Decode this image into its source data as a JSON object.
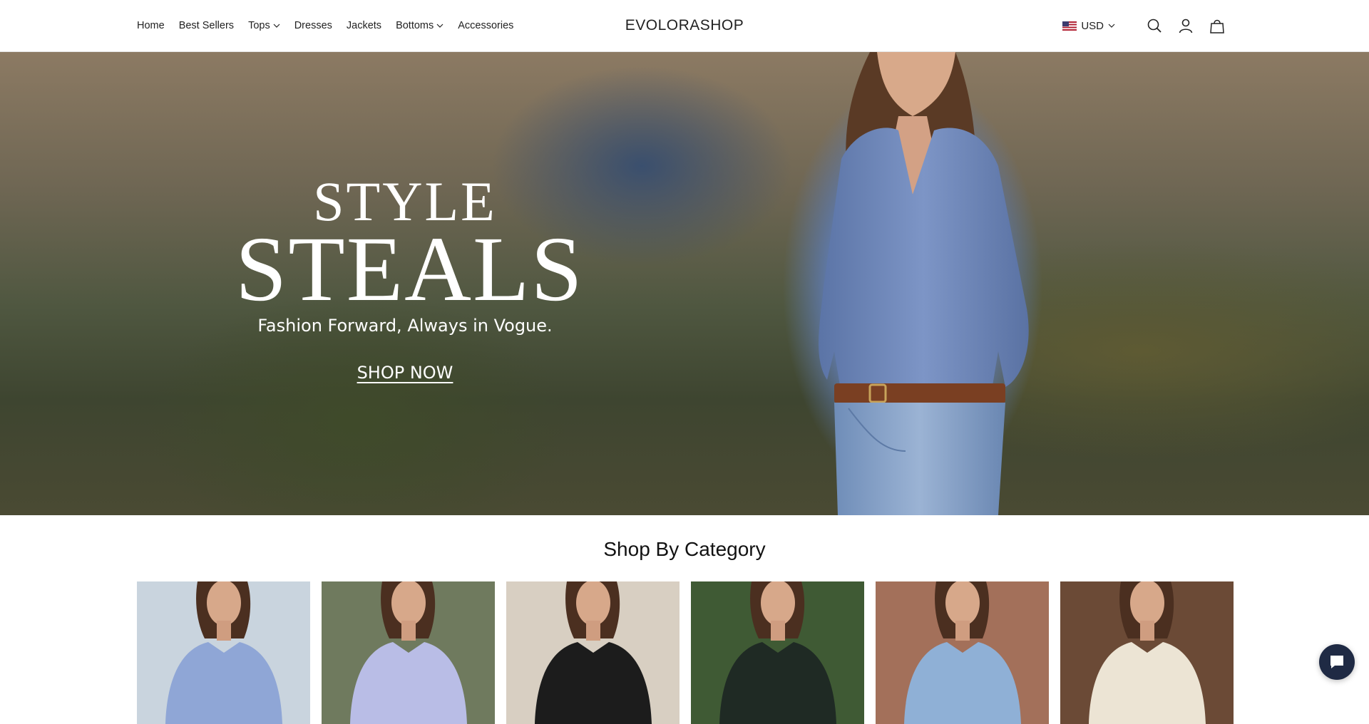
{
  "header": {
    "nav": [
      {
        "label": "Home",
        "has_dropdown": false
      },
      {
        "label": "Best Sellers",
        "has_dropdown": false
      },
      {
        "label": "Tops",
        "has_dropdown": true
      },
      {
        "label": "Dresses",
        "has_dropdown": false
      },
      {
        "label": "Jackets",
        "has_dropdown": false
      },
      {
        "label": "Bottoms",
        "has_dropdown": true
      },
      {
        "label": "Accessories",
        "has_dropdown": false
      }
    ],
    "logo": "EVOLORASHOP",
    "currency": "USD",
    "icons": [
      "us-flag-icon",
      "search-icon",
      "account-icon",
      "cart-icon"
    ]
  },
  "hero": {
    "line1": "STYLE",
    "line2": "STEALS",
    "tagline": "Fashion Forward, Always in Vogue.",
    "cta": "SHOP NOW"
  },
  "category": {
    "title": "Shop By Category",
    "cards": [
      {
        "name": "category-card-1",
        "bg": "#c9d4de",
        "shirt": "#8fa6d6"
      },
      {
        "name": "category-card-2",
        "bg": "#6f7a5e",
        "shirt": "#b9bde6"
      },
      {
        "name": "category-card-3",
        "bg": "#d8cfc2",
        "shirt": "#1c1c1c"
      },
      {
        "name": "category-card-4",
        "bg": "#3f5a34",
        "shirt": "#1f2a24"
      },
      {
        "name": "category-card-5",
        "bg": "#a3705a",
        "shirt": "#8fb0d6"
      },
      {
        "name": "category-card-6",
        "bg": "#6b4a36",
        "shirt": "#ece4d4"
      }
    ]
  },
  "colors": {
    "chat_button": "#1f2a44",
    "text": "#121212"
  }
}
